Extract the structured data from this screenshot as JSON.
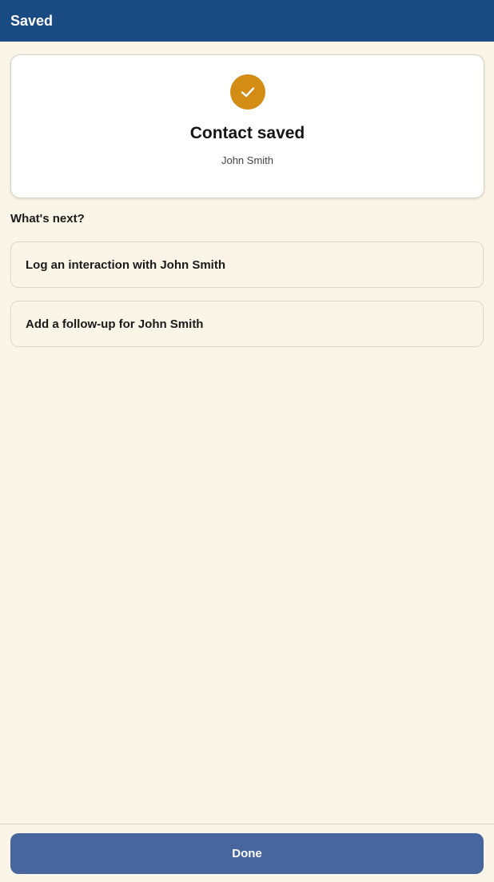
{
  "app_bar": {
    "title": "Saved"
  },
  "confirmation": {
    "icon": "check-icon",
    "title": "Contact saved",
    "subtitle": "John Smith",
    "accent_color": "#d38c14"
  },
  "next_steps": {
    "heading": "What's next?",
    "actions": [
      {
        "label": "Log an interaction with John Smith"
      },
      {
        "label": "Add a follow-up for John Smith"
      }
    ]
  },
  "footer": {
    "done_label": "Done",
    "button_color": "#46669d"
  },
  "colors": {
    "header": "#1a4a82",
    "background": "#faf5e7"
  }
}
